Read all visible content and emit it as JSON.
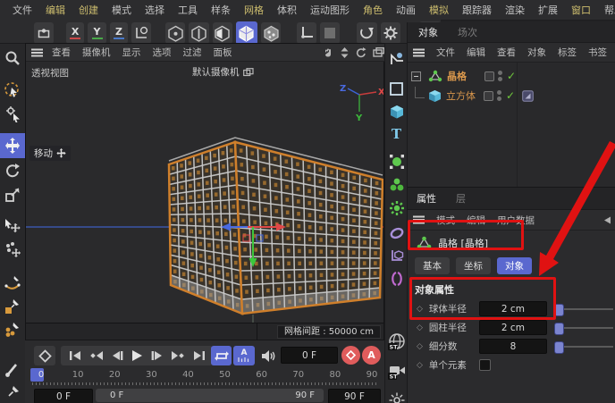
{
  "menu_bar": {
    "items": [
      {
        "label": "文件",
        "hl": false
      },
      {
        "label": "编辑",
        "hl": true
      },
      {
        "label": "创建",
        "hl": true
      },
      {
        "label": "模式",
        "hl": false
      },
      {
        "label": "选择",
        "hl": false
      },
      {
        "label": "工具",
        "hl": false
      },
      {
        "label": "样条",
        "hl": false
      },
      {
        "label": "网格",
        "hl": true
      },
      {
        "label": "体积",
        "hl": false
      },
      {
        "label": "运动图形",
        "hl": false
      },
      {
        "label": "角色",
        "hl": true
      },
      {
        "label": "动画",
        "hl": false
      },
      {
        "label": "模拟",
        "hl": true
      },
      {
        "label": "跟踪器",
        "hl": false
      },
      {
        "label": "渲染",
        "hl": false
      },
      {
        "label": "扩展",
        "hl": false
      },
      {
        "label": "窗口",
        "hl": true
      },
      {
        "label": "帮助",
        "hl": false
      }
    ]
  },
  "toolbar": {
    "x": "X",
    "y": "Y",
    "z": "Z",
    "snap": "#"
  },
  "viewport": {
    "menu": [
      "查看",
      "摄像机",
      "显示",
      "选项",
      "过滤",
      "面板"
    ],
    "view_label": "透视视图",
    "camera_label": "默认摄像机",
    "tool_hint": "移动",
    "grid_spacing": "网格间距 : 50000 cm",
    "axis": {
      "x": "X",
      "y": "Y",
      "z": "Z"
    },
    "cube": {
      "rows": 12,
      "left_cols": 8,
      "right_cols": 13
    }
  },
  "object_manager": {
    "tabs": [
      "对象",
      "场次"
    ],
    "menu": [
      "文件",
      "编辑",
      "查看",
      "对象",
      "标签",
      "书签"
    ],
    "items": [
      {
        "name": "晶格"
      },
      {
        "name": "立方体"
      }
    ]
  },
  "attributes": {
    "tabs": [
      "属性",
      "层"
    ],
    "menu": [
      "模式",
      "编辑",
      "用户数据"
    ],
    "object_title": "晶格 [晶格]",
    "section_tabs": [
      "基本",
      "坐标",
      "对象"
    ],
    "section_header": "对象属性",
    "rows": [
      {
        "label": "球体半径",
        "value": "2 cm"
      },
      {
        "label": "圆柱半径",
        "value": "2 cm"
      },
      {
        "label": "细分数",
        "value": "8"
      },
      {
        "label": "单个元素",
        "value": ""
      }
    ]
  },
  "timeline": {
    "frame_field": "0 F",
    "ticks": [
      "0",
      "10",
      "20",
      "30",
      "40",
      "50",
      "60",
      "70",
      "80",
      "90"
    ],
    "start_field": "0 F",
    "range_start": "0 F",
    "range_end": "90 F",
    "end_field": "90 F"
  },
  "right_toolbar": {
    "st_badge": "ST"
  },
  "colors": {
    "accent_blue": "#5a68cf",
    "menu_highlight": "#cdbd6e",
    "object_orange": "#d9974c",
    "check_green": "#6fc83c",
    "annotation_red": "#e01212",
    "cube_edge": "#cf7f2b"
  }
}
